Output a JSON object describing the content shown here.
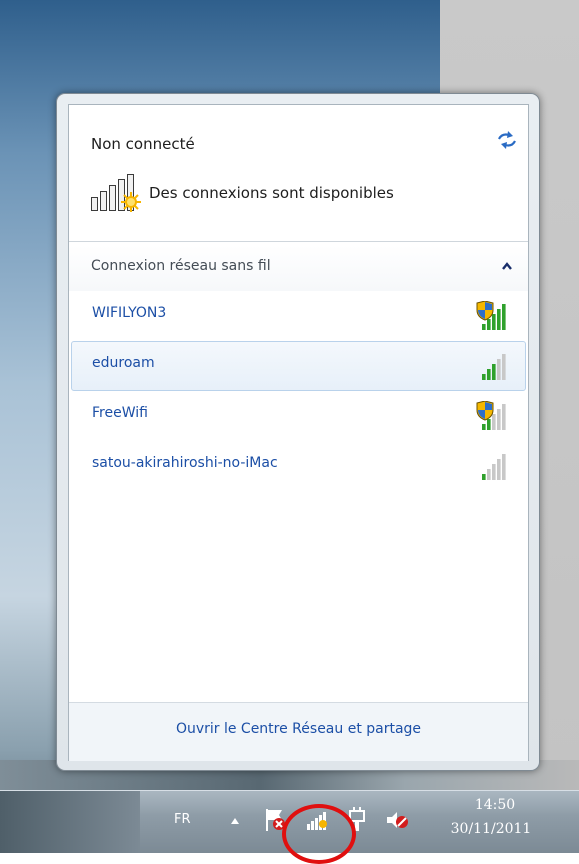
{
  "flyout": {
    "status_title": "Non connecté",
    "available_text": "Des connexions sont disponibles",
    "section_label": "Connexion réseau sans fil",
    "networks": [
      {
        "name": "WIFILYON3",
        "secured": true,
        "signal_bars": 5,
        "selected": false
      },
      {
        "name": "eduroam",
        "secured": false,
        "signal_bars": 3,
        "selected": true
      },
      {
        "name": "FreeWifi",
        "secured": true,
        "signal_bars": 2,
        "selected": false
      },
      {
        "name": "satou-akirahiroshi-no-iMac",
        "secured": false,
        "signal_bars": 1,
        "selected": false
      }
    ],
    "footer_link": "Ouvrir le Centre Réseau et partage"
  },
  "taskbar": {
    "language": "FR",
    "time": "14:50",
    "date": "30/11/2011",
    "tray_icons": [
      "show-hidden-icons-arrow",
      "action-center-flag-icon",
      "network-signal-icon",
      "power-plug-icon",
      "volume-muted-icon"
    ]
  },
  "colors": {
    "link": "#1c4fa6",
    "signal_green": "#2fa12c",
    "signal_gray": "#c8c8c8",
    "highlight": "#e00f0f"
  }
}
